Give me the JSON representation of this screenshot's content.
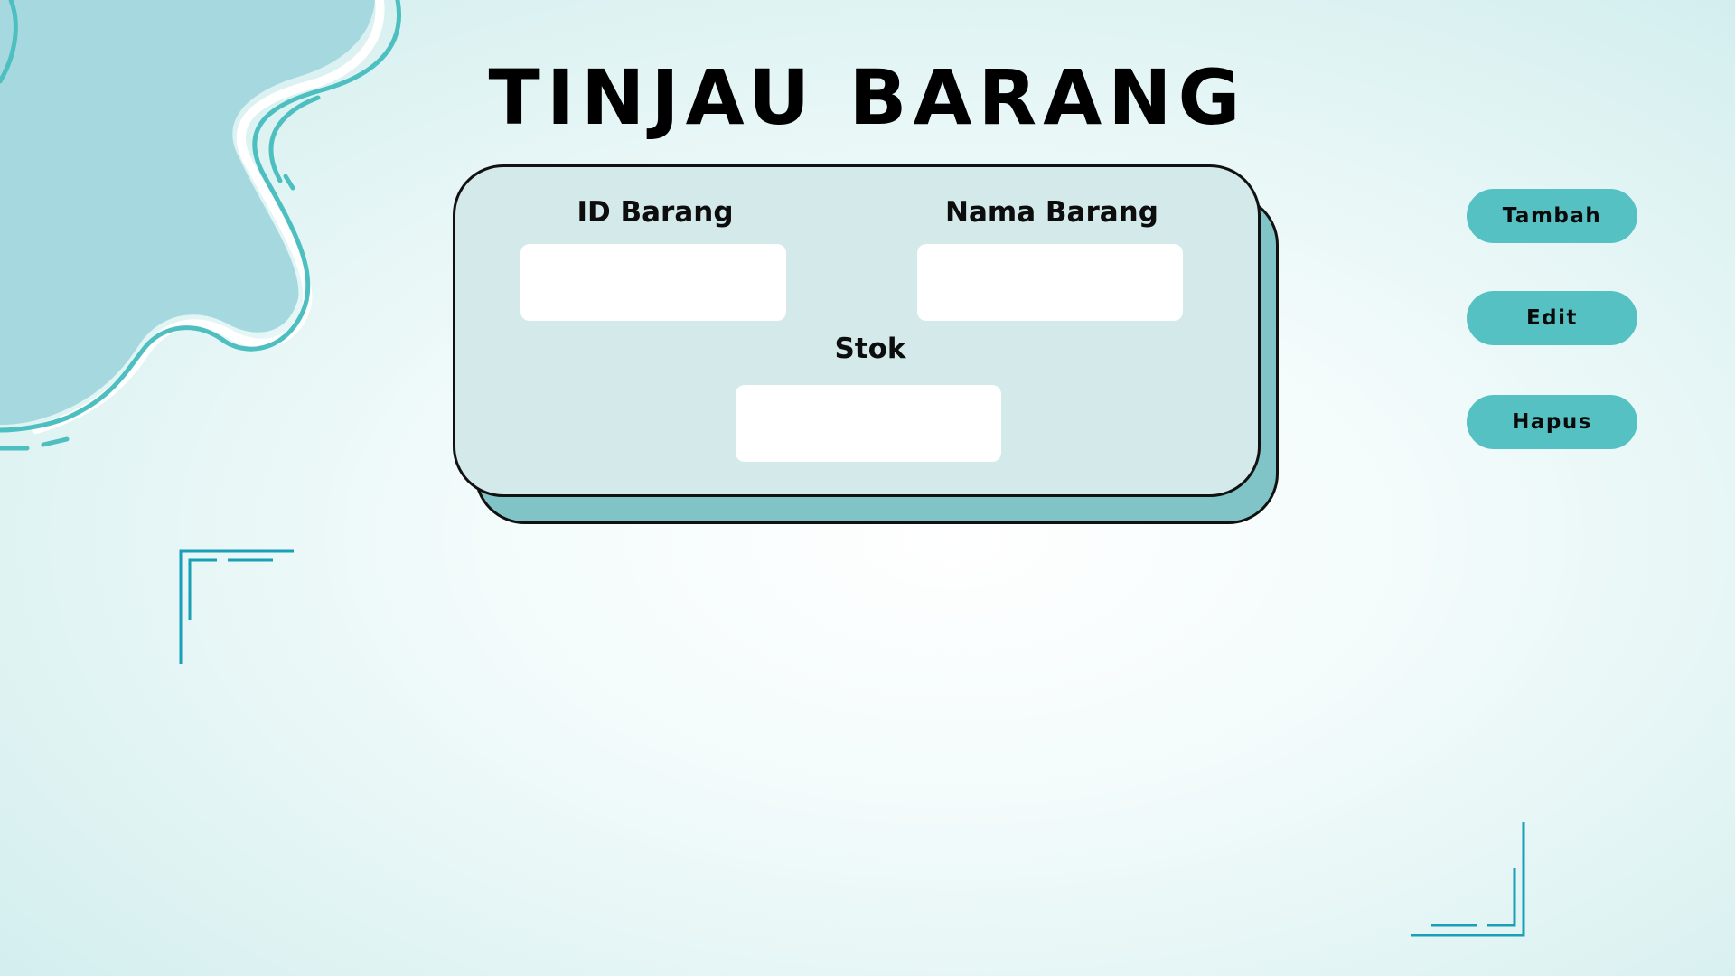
{
  "page": {
    "title": "TINJAU BARANG"
  },
  "form": {
    "id_label": "ID Barang",
    "id_value": "",
    "name_label": "Nama Barang",
    "name_value": "",
    "stock_label": "Stok",
    "stock_value": ""
  },
  "actions": {
    "add_label": "Tambah",
    "edit_label": "Edit",
    "delete_label": "Hapus"
  },
  "colors": {
    "accent": "#55c1c2",
    "card": "#d3e9ea",
    "card_shadow": "#80c4c8",
    "blob": "#a6d9df",
    "line": "#1a9fb6"
  }
}
